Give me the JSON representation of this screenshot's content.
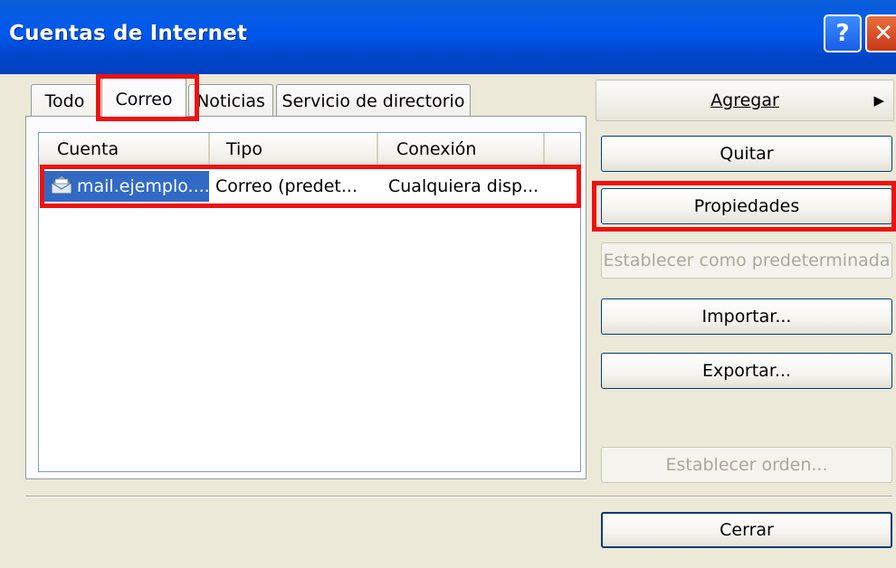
{
  "window": {
    "title": "Cuentas de Internet",
    "help_label": "?",
    "close_label": "✕"
  },
  "tabs": [
    {
      "label": "Todo",
      "active": false
    },
    {
      "label": "Correo",
      "active": true
    },
    {
      "label": "Noticias",
      "active": false
    },
    {
      "label": "Servicio de directorio",
      "active": false
    }
  ],
  "list": {
    "columns": [
      "Cuenta",
      "Tipo",
      "Conexión"
    ],
    "rows": [
      {
        "cuenta": "mail.ejemplo....",
        "tipo": "Correo (predet...",
        "conexion": "Cualquiera disp...",
        "icon": "mail-account-icon",
        "selected": true
      }
    ]
  },
  "buttons": {
    "agregar": "Agregar",
    "agregar_arrow": "▶",
    "quitar": "Quitar",
    "propiedades": "Propiedades",
    "establecer": "Establecer como predeterminada",
    "importar": "Importar...",
    "exportar": "Exportar...",
    "orden": "Establecer orden...",
    "cerrar": "Cerrar"
  },
  "colors": {
    "titlebar": "#0058ee",
    "highlight": "#ee1111",
    "selection": "#316ac5"
  }
}
